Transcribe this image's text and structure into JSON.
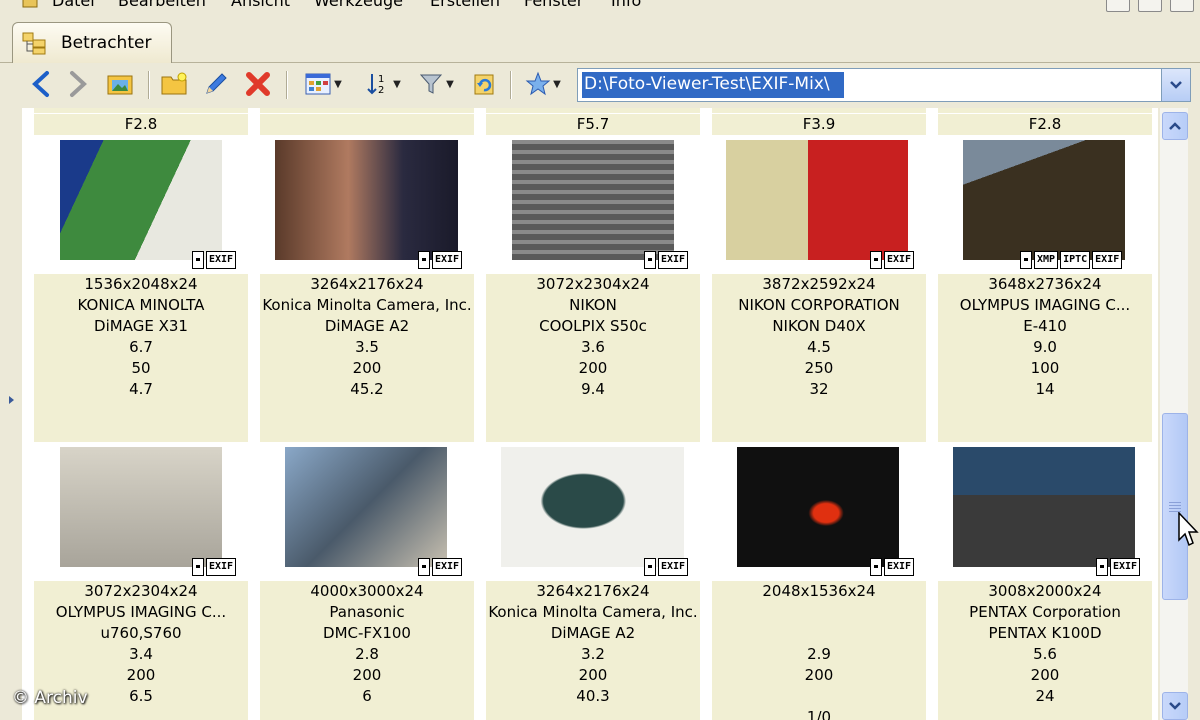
{
  "menu": {
    "items": [
      "Datei",
      "Bearbeiten",
      "Ansicht",
      "Werkzeuge",
      "Erstellen",
      "Fenster",
      "Info"
    ]
  },
  "tab": {
    "label": "Betrachter"
  },
  "toolbar": {
    "icons": [
      "arrow-left-icon",
      "arrow-right-icon",
      "folder-image-icon",
      "new-folder-icon",
      "pencil-icon",
      "delete-icon",
      "view-mode-icon",
      "sort-icon",
      "filter-icon",
      "refresh-icon",
      "favorites-star-icon",
      "path-dropdown-icon"
    ]
  },
  "path": {
    "value": "D:\\Foto-Viewer-Test\\EXIF-Mix\\"
  },
  "top_partial": [
    "F2.8",
    "",
    "F5.7",
    "F3.9",
    "F2.8"
  ],
  "rows": [
    {
      "items": [
        {
          "badges": [
            "EXIF"
          ],
          "res": "1536x2048x24",
          "make": "KONICA MINOLTA",
          "model": "DiMAGE X31",
          "v1": "6.7",
          "v2": "50",
          "v3": "4.7"
        },
        {
          "badges": [
            "EXIF"
          ],
          "res": "3264x2176x24",
          "make": "Konica Minolta Camera, Inc.",
          "model": "DiMAGE A2",
          "v1": "3.5",
          "v2": "200",
          "v3": "45.2"
        },
        {
          "badges": [
            "EXIF"
          ],
          "res": "3072x2304x24",
          "make": "NIKON",
          "model": "COOLPIX S50c",
          "v1": "3.6",
          "v2": "200",
          "v3": "9.4"
        },
        {
          "badges": [
            "EXIF"
          ],
          "res": "3872x2592x24",
          "make": "NIKON CORPORATION",
          "model": "NIKON D40X",
          "v1": "4.5",
          "v2": "250",
          "v3": "32"
        },
        {
          "badges": [
            "XMP",
            "IPTC",
            "EXIF"
          ],
          "res": "3648x2736x24",
          "make": "OLYMPUS IMAGING C...",
          "model": "E-410",
          "v1": "9.0",
          "v2": "100",
          "v3": "14"
        }
      ]
    },
    {
      "items": [
        {
          "badges": [
            "EXIF"
          ],
          "res": "3072x2304x24",
          "make": "OLYMPUS IMAGING C...",
          "model": "u760,S760",
          "v1": "3.4",
          "v2": "200",
          "v3": "6.5"
        },
        {
          "badges": [
            "EXIF"
          ],
          "res": "4000x3000x24",
          "make": "Panasonic",
          "model": "DMC-FX100",
          "v1": "2.8",
          "v2": "200",
          "v3": "6"
        },
        {
          "badges": [
            "EXIF"
          ],
          "res": "3264x2176x24",
          "make": "Konica Minolta Camera, Inc.",
          "model": "DiMAGE A2",
          "v1": "3.2",
          "v2": "200",
          "v3": "40.3"
        },
        {
          "badges": [
            "EXIF"
          ],
          "res": "2048x1536x24",
          "make": "",
          "model": "",
          "v1": "2.9",
          "v2": "200",
          "v3": ""
        },
        {
          "badges": [
            "EXIF"
          ],
          "res": "3008x2000x24",
          "make": "PENTAX Corporation",
          "model": "PENTAX K100D",
          "v1": "5.6",
          "v2": "200",
          "v3": "24"
        }
      ]
    }
  ],
  "watermark": "© Archiv"
}
